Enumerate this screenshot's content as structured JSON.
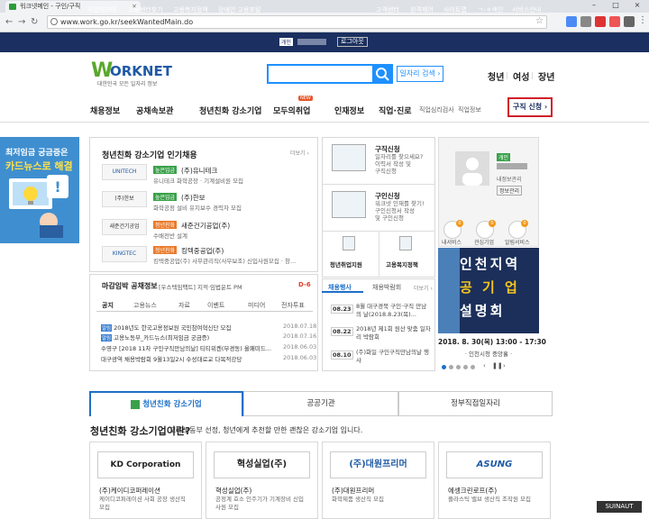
{
  "browser": {
    "tab_title": "워크넷메인 - 구인/구직",
    "url": "www.work.go.kr/seekWantedMain.do"
  },
  "utility": {
    "links": [
      "직업워크넷",
      "고용센터찾기",
      "고용복지정책",
      "장애인 고용포털"
    ],
    "user_badge": "개인",
    "logout": "로그아웃",
    "right_links": [
      "고객센터",
      "원격제어",
      "사이트맵",
      "ㄱ-ㅎ색인",
      "서비스안내"
    ]
  },
  "header": {
    "logo_w": "W",
    "logo_rest": "ORKNET",
    "logo_sub": "대한민국 모든 일자리 정보",
    "search_placeholder": "",
    "detail_search": "일자리 검색 ›",
    "quick_links": [
      "청년",
      "여성",
      "장년"
    ]
  },
  "gnb": {
    "items": [
      "채용정보",
      "공채속보관",
      "청년친화 강소기업",
      "모두의취업",
      "인재정보",
      "직업·진로"
    ],
    "small": [
      "직업심리검사",
      "직업정보"
    ],
    "new_badge": "NEW",
    "apply_button": "구직 신청 ›"
  },
  "banner": {
    "line1": "최저임금 궁금증은",
    "line2": "카드뉴스로 해결"
  },
  "youth": {
    "title": "청년친화 강소기업 인기채용",
    "more": "더보기 ›",
    "companies": [
      {
        "badge": "높은임금",
        "name": "(주)유니테크",
        "desc": "유니테크 화학공장 · 기계설비원 모집"
      },
      {
        "badge": "높은임금",
        "name": "(주)한보",
        "desc": "화학공정 설비 유지보수 경력자 모집"
      },
      {
        "badge": "청년친화",
        "name": "새준건기공업(주)",
        "desc": "수배전반 설계"
      },
      {
        "badge": "청년친화",
        "name": "킹텍중공업(주)",
        "desc": "킹텍중공업(주) 사무관리직(사무보조) 신입사원모집 · 창..."
      }
    ],
    "logo_labels": [
      "UNITECH",
      "(주)한보",
      "새준건기공업",
      "KINGTEC"
    ]
  },
  "notice": {
    "title": "마감임박 공채정보",
    "sub": "[우스텍임팩트] 지적·임법운트 PM",
    "dday": "D-6",
    "tabs": [
      "공지",
      "고용뉴스",
      "자료",
      "이벤트",
      "미디어",
      "전자투표"
    ],
    "more": "더보기 ›",
    "items": [
      {
        "tag": "알림",
        "text": "2018년도 한국고용정보원 국민참여혁신단 모집",
        "date": "2018.07.18"
      },
      {
        "tag": "알림",
        "text": "고용노동부_카드뉴스(최저임금 궁금증)",
        "date": "2018.07.16"
      },
      {
        "tag": "",
        "text": "수영구 [2018 11차 구인구직만남의날] 티티위켄(부경동) 올패미드...",
        "date": "2018.06.03"
      },
      {
        "tag": "",
        "text": "대구광역 채용박람회 9월13일2시 수성대로교 다목적강당",
        "date": "2018.06.03"
      }
    ]
  },
  "services": {
    "jobseeker": {
      "title": "구직신청",
      "desc": "일자리를 찾으세요?\n이력서 작성 및\n구직신청"
    },
    "employer": {
      "title": "구인신청",
      "desc": "워크넷 인재를 찾기!\n구인신청서 작성\n및 구인신청"
    },
    "youth_support": "청년취업지원",
    "employment_welfare": "고용복지정책"
  },
  "events": {
    "tabs": [
      "채용행사",
      "채용박람회"
    ],
    "more": "더보기 ›",
    "items": [
      {
        "date": "08.23",
        "text": "8월 대구경북 구인·구직 만남의 날(2018.8.23(목)..."
      },
      {
        "date": "08.22",
        "text": "2018년 제1회 원산 맞춤 일자리 박람회"
      },
      {
        "date": "08.10",
        "text": "(주)화일 구인구직만남의날 행사"
      }
    ]
  },
  "profile": {
    "badge": "개인",
    "line1": "내정보관리",
    "manage_button": "정보관리",
    "stats": [
      {
        "label": "내서비스",
        "count": "0"
      },
      {
        "label": "관심기업",
        "count": "0"
      },
      {
        "label": "알림서비스",
        "count": "0"
      }
    ]
  },
  "event_banner": {
    "line1": "인천지역",
    "line2": "공 기 업",
    "line3": "설명회",
    "date": "2018. 8. 30(목) 13:00 - 17:30",
    "venue": "· 인천시청 중앙홀 ·"
  },
  "bottom_tabs": [
    "청년친화 강소기업",
    "공공기관",
    "정부직접일자리"
  ],
  "intro": {
    "title": "청년친화 강소기업이란?",
    "text": "고용노동부 선정, 청년에게 추천할 만한 괜찮은 강소기업 입니다."
  },
  "cards": [
    {
      "logo": "KD Corporation",
      "name": "(주)케이디코퍼레이션",
      "desc": "케이디코퍼레이션 사회 공장 생산직\n모집"
    },
    {
      "logo": "혁성실업(주)",
      "name": "혁성실업(주)",
      "desc": "공정계 효소 인주기가 기계장비 신입\n사원 모집"
    },
    {
      "logo": "(주)대원프리머",
      "name": "(주)대원프리머",
      "desc": "화학제품 생산직 모집"
    },
    {
      "logo": "ASUNG",
      "name": "에셍크린로프(주)",
      "desc": "플라스틱 밸브 생산직 조작원 모집"
    }
  ],
  "overlay": "SUINAUT"
}
